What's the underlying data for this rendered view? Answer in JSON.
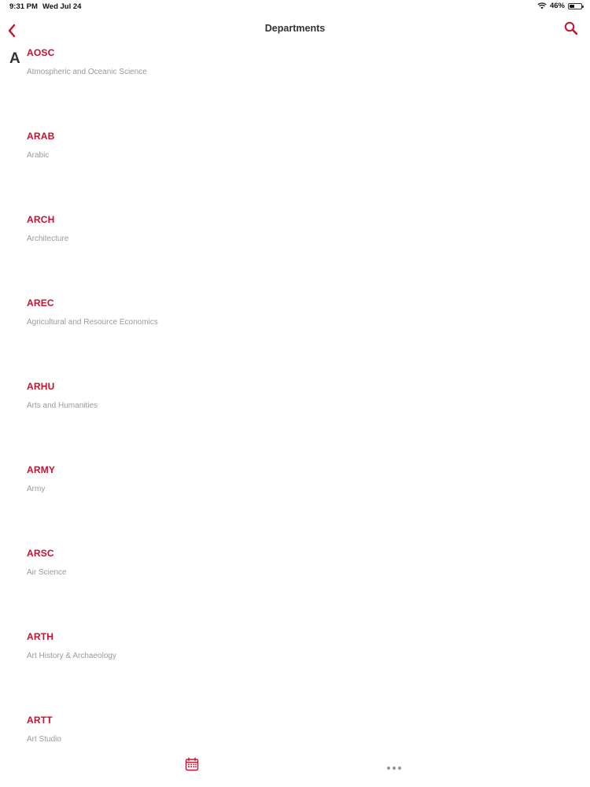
{
  "status_bar": {
    "time": "9:31 PM",
    "date": "Wed Jul 24",
    "battery_percent": "46%",
    "battery_level": 0.46,
    "wifi_icon": "wifi-icon",
    "battery_icon": "battery-icon"
  },
  "nav": {
    "title": "Departments",
    "back_icon": "chevron-left-icon",
    "search_icon": "search-icon"
  },
  "colors": {
    "accent": "#c8102e",
    "subtitle": "#9a9a9a",
    "title": "#333333"
  },
  "section": {
    "letter": "A"
  },
  "departments": [
    {
      "code": "AOSC",
      "name": "Atmospheric and Oceanic Science"
    },
    {
      "code": "ARAB",
      "name": "Arabic"
    },
    {
      "code": "ARCH",
      "name": "Architecture"
    },
    {
      "code": "AREC",
      "name": "Agricultural and Resource Economics"
    },
    {
      "code": "ARHU",
      "name": "Arts and Humanities"
    },
    {
      "code": "ARMY",
      "name": "Army"
    },
    {
      "code": "ARSC",
      "name": "Air Science"
    },
    {
      "code": "ARTH",
      "name": "Art History & Archaeology"
    },
    {
      "code": "ARTT",
      "name": "Art Studio"
    }
  ],
  "tab_bar": {
    "calendar_icon": "calendar-icon",
    "more_icon": "more-dots-icon"
  }
}
